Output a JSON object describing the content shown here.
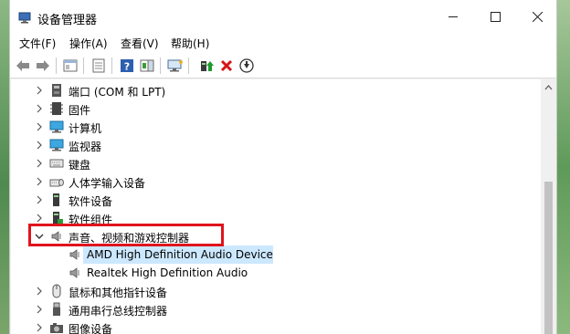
{
  "window": {
    "title": "设备管理器"
  },
  "menu": [
    {
      "label": "文件(F)"
    },
    {
      "label": "操作(A)"
    },
    {
      "label": "查看(V)"
    },
    {
      "label": "帮助(H)"
    }
  ],
  "toolbar": {
    "buttons": [
      "back-icon",
      "forward-icon",
      "properties-pane-icon",
      "update-list-icon",
      "help-icon",
      "show-pane-icon",
      "scan-hardware-icon",
      "update-driver-icon",
      "uninstall-icon",
      "download-icon"
    ]
  },
  "tree": {
    "items": [
      {
        "label": "端口 (COM 和 LPT)",
        "icon": "port-icon",
        "expanded": false
      },
      {
        "label": "固件",
        "icon": "firmware-icon",
        "expanded": false
      },
      {
        "label": "计算机",
        "icon": "computer-icon",
        "expanded": false
      },
      {
        "label": "监视器",
        "icon": "monitor-icon",
        "expanded": false
      },
      {
        "label": "键盘",
        "icon": "keyboard-icon",
        "expanded": false
      },
      {
        "label": "人体学输入设备",
        "icon": "hid-icon",
        "expanded": false
      },
      {
        "label": "软件设备",
        "icon": "software-device-icon",
        "expanded": false
      },
      {
        "label": "软件组件",
        "icon": "software-component-icon",
        "expanded": false
      },
      {
        "label": "声音、视频和游戏控制器",
        "icon": "speaker-icon",
        "expanded": true,
        "children": [
          {
            "label": "AMD High Definition Audio Device",
            "icon": "speaker-icon",
            "selected": true
          },
          {
            "label": "Realtek High Definition Audio",
            "icon": "speaker-icon",
            "selected": false
          }
        ]
      },
      {
        "label": "鼠标和其他指针设备",
        "icon": "mouse-icon",
        "expanded": false
      },
      {
        "label": "通用串行总线控制器",
        "icon": "usb-icon",
        "expanded": false
      },
      {
        "label": "图像设备",
        "icon": "camera-icon",
        "expanded": false
      }
    ]
  },
  "colors": {
    "selection": "#cce8ff",
    "highlight_box": "#e0141c",
    "desktop": "#6f9d6a"
  }
}
